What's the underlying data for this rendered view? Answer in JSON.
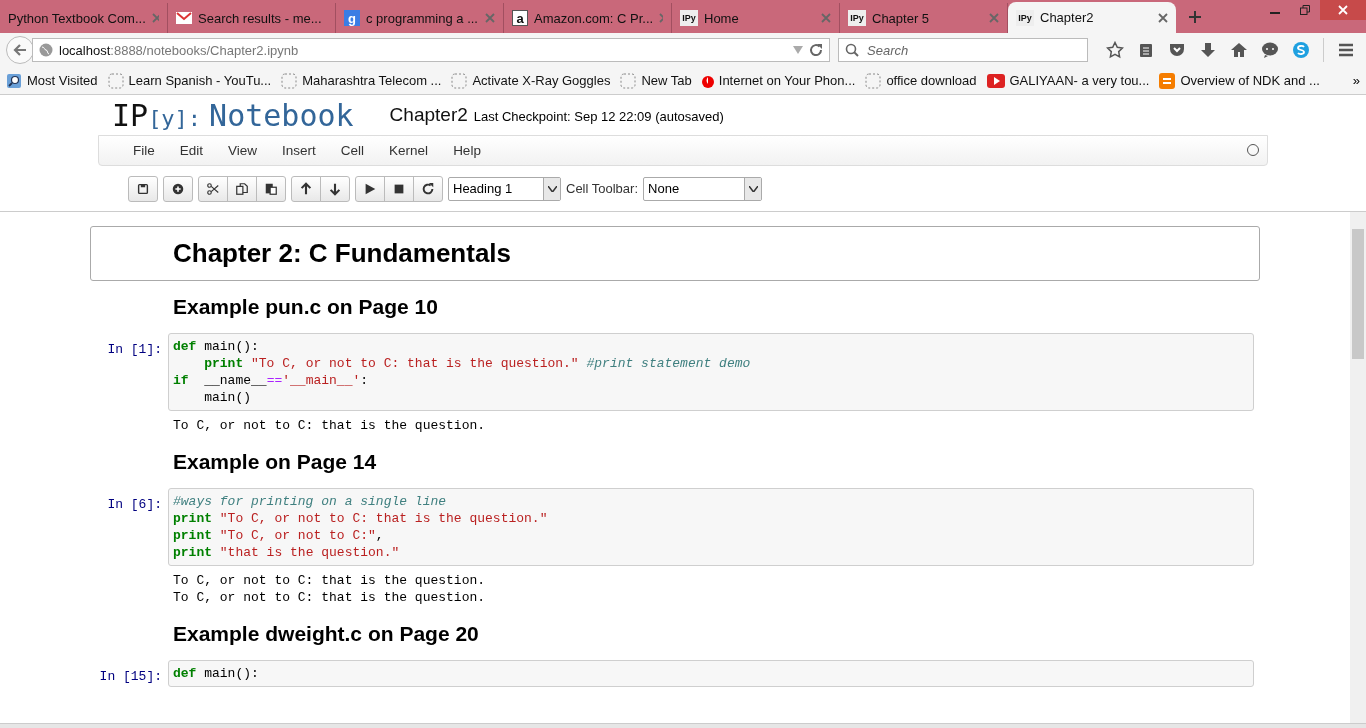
{
  "browser": {
    "tabs": [
      {
        "title": "Python Textbook Com...",
        "kind": "none",
        "selected": false
      },
      {
        "title": "Search results - me...",
        "kind": "mail",
        "selected": false
      },
      {
        "title": "c programming a ...",
        "kind": "letter",
        "favicon_text": "g",
        "selected": false
      },
      {
        "title": "Amazon.com: C Pr...",
        "kind": "letter-dark",
        "favicon_text": "a",
        "selected": false
      },
      {
        "title": "Home",
        "kind": "ipy",
        "favicon_text": "IPy",
        "selected": false
      },
      {
        "title": "Chapter 5",
        "kind": "ipy",
        "favicon_text": "IPy",
        "selected": false
      },
      {
        "title": "Chapter2",
        "kind": "ipy",
        "favicon_text": "IPy",
        "selected": true
      }
    ],
    "address": {
      "host": "localhost",
      "path": ":8888/notebooks/Chapter2.ipynb"
    },
    "search": {
      "placeholder": "Search"
    },
    "bookmarks": [
      {
        "label": "Most Visited",
        "kind": "magnifier"
      },
      {
        "label": "Learn Spanish - YouTu...",
        "kind": "blank"
      },
      {
        "label": "Maharashtra Telecom ...",
        "kind": "blank"
      },
      {
        "label": "Activate X-Ray Goggles",
        "kind": "blank"
      },
      {
        "label": "New Tab",
        "kind": "blank"
      },
      {
        "label": "Internet on Your Phon...",
        "kind": "drop"
      },
      {
        "label": "office download",
        "kind": "blank"
      },
      {
        "label": "GALIYAAN- a very tou...",
        "kind": "play"
      },
      {
        "label": "Overview of NDK and ...",
        "kind": "blog"
      }
    ],
    "bookmarks_overflow": "»"
  },
  "notebook": {
    "logo_prefix": "IP",
    "logo_bracket": "[y]:",
    "logo_word": "Notebook",
    "name": "Chapter2",
    "checkpoint": "Last Checkpoint: Sep 12 22:09 (autosaved)",
    "menu": [
      "File",
      "Edit",
      "View",
      "Insert",
      "Cell",
      "Kernel",
      "Help"
    ],
    "toolbar_groups": [
      [
        {
          "kind": "save"
        }
      ],
      [
        {
          "kind": "insert"
        }
      ],
      [
        {
          "kind": "cut"
        },
        {
          "kind": "copy"
        },
        {
          "kind": "paste"
        }
      ],
      [
        {
          "kind": "up"
        },
        {
          "kind": "down"
        }
      ],
      [
        {
          "kind": "run"
        },
        {
          "kind": "stop"
        },
        {
          "kind": "restart"
        }
      ]
    ],
    "cell_type": "Heading 1",
    "cell_toolbar_label": "Cell Toolbar:",
    "cell_toolbar": "None"
  },
  "cells": [
    {
      "kind": "heading1",
      "text": "Chapter 2: C Fundamentals"
    },
    {
      "kind": "heading2",
      "text": "Example pun.c on Page 10"
    },
    {
      "kind": "code",
      "prompt": "In [1]:",
      "lines": [
        {
          "indented": false,
          "tokens": [
            {
              "kind": "keyword",
              "s": "def"
            },
            {
              "kind": "plain",
              "s": " main():"
            }
          ]
        },
        {
          "indented": true,
          "tokens": [
            {
              "kind": "keyword",
              "s": "print"
            },
            {
              "kind": "string",
              "s": " \"To C, or not to C: that is the question.\""
            },
            {
              "kind": "comment",
              "s": " #print statement demo"
            }
          ]
        },
        {
          "indented": false,
          "tokens": [
            {
              "kind": "keyword",
              "s": "if"
            },
            {
              "kind": "plain",
              "s": "  __name__"
            },
            {
              "kind": "operator",
              "s": "=="
            },
            {
              "kind": "string",
              "s": "'__main__'"
            },
            {
              "kind": "plain",
              "s": ":"
            }
          ]
        },
        {
          "indented": true,
          "tokens": [
            {
              "kind": "plain",
              "s": "main()"
            }
          ]
        }
      ],
      "output": [
        "To C, or not to C: that is the question."
      ]
    },
    {
      "kind": "heading2",
      "text": "Example on Page 14"
    },
    {
      "kind": "code",
      "prompt": "In [6]:",
      "lines": [
        {
          "indented": false,
          "tokens": [
            {
              "kind": "comment",
              "s": "#ways for printing on a single line"
            }
          ]
        },
        {
          "indented": false,
          "tokens": [
            {
              "kind": "keyword",
              "s": "print"
            },
            {
              "kind": "string",
              "s": " \"To C, or not to C: that is the question.\""
            }
          ]
        },
        {
          "indented": false,
          "tokens": [
            {
              "kind": "keyword",
              "s": "print"
            },
            {
              "kind": "string",
              "s": " \"To C, or not to C:\""
            },
            {
              "kind": "plain",
              "s": ","
            }
          ]
        },
        {
          "indented": false,
          "tokens": [
            {
              "kind": "keyword",
              "s": "print"
            },
            {
              "kind": "string",
              "s": " \"that is the question.\""
            }
          ]
        }
      ],
      "output": [
        "To C, or not to C: that is the question.",
        "To C, or not to C: that is the question."
      ]
    },
    {
      "kind": "heading2",
      "text": "Example dweight.c on Page 20"
    },
    {
      "kind": "code",
      "prompt": "In [15]:",
      "lines": [
        {
          "indented": false,
          "tokens": [
            {
              "kind": "keyword",
              "s": "def"
            },
            {
              "kind": "plain",
              "s": " main():"
            }
          ]
        }
      ]
    }
  ]
}
